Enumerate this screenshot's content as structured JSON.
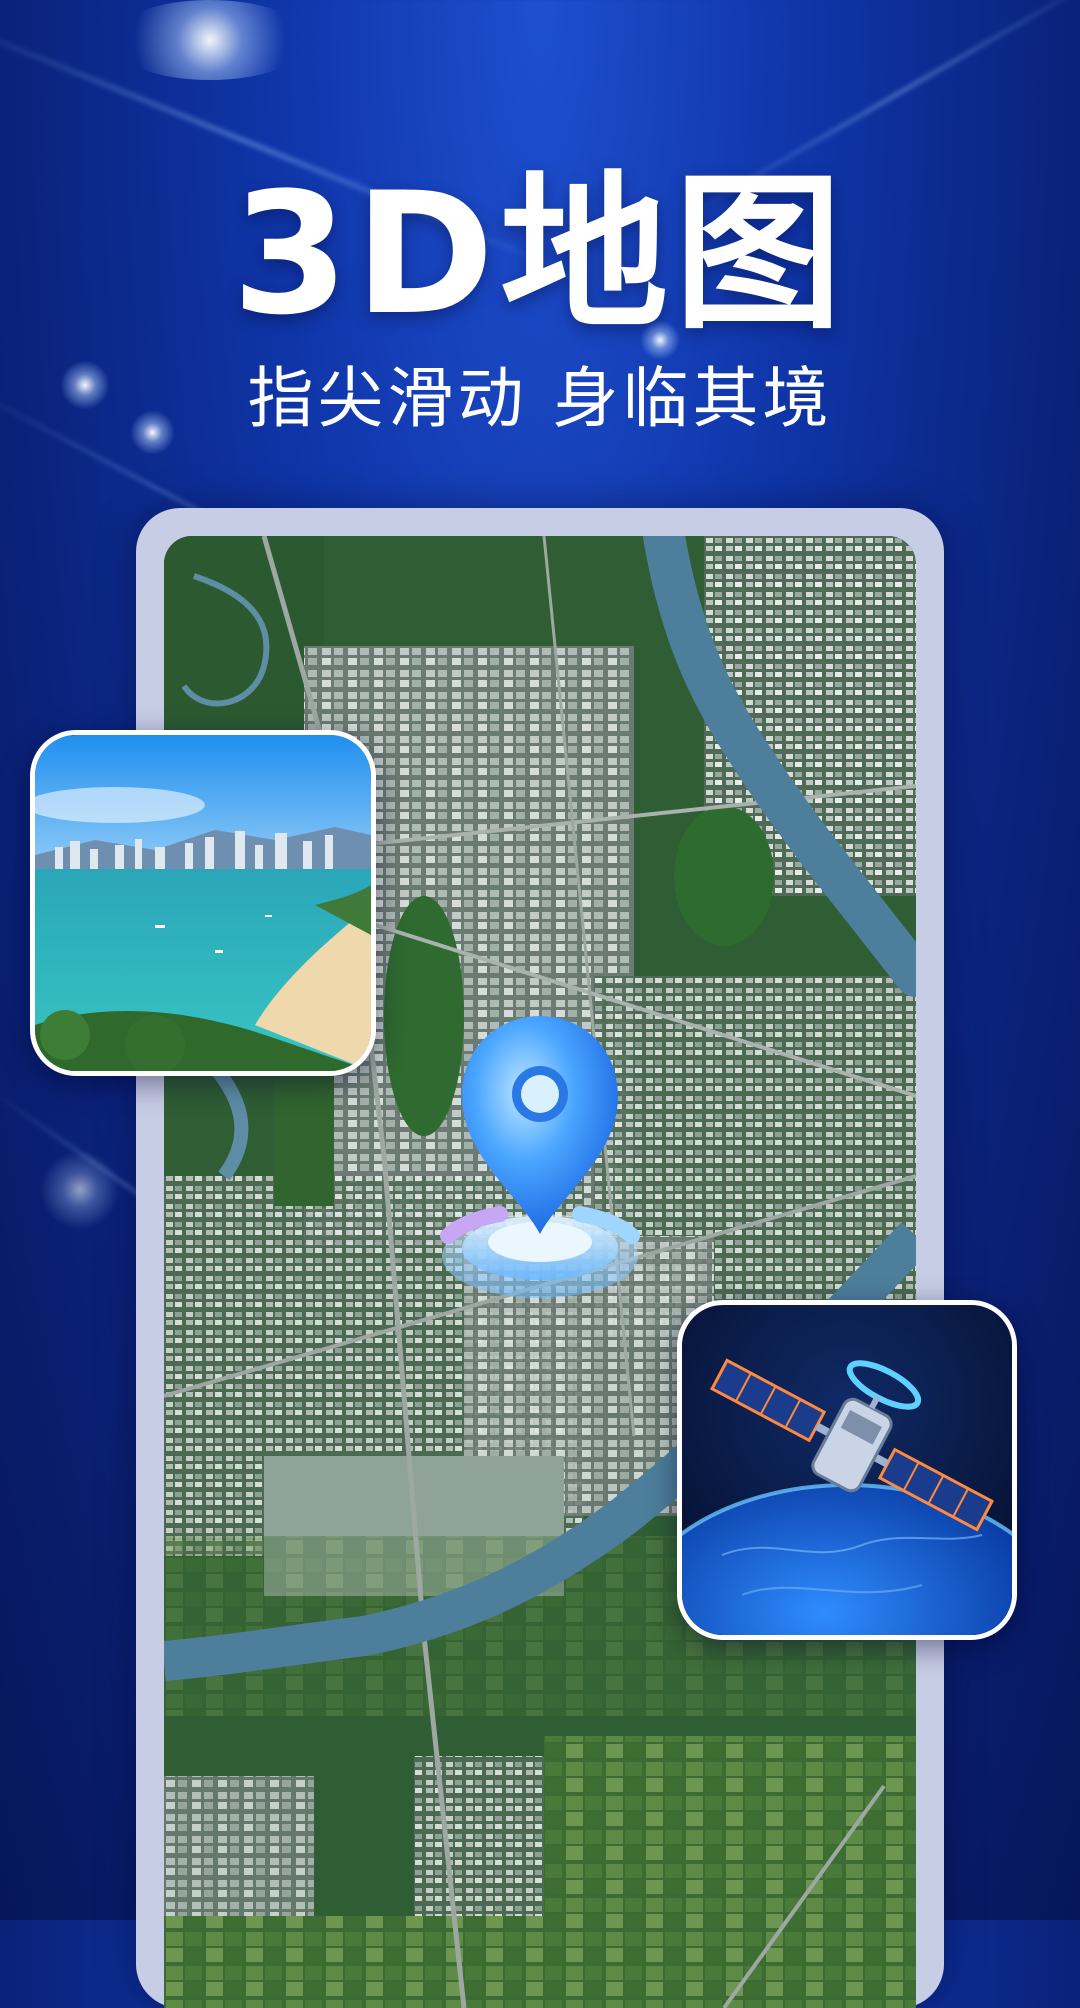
{
  "hero": {
    "title": "3D地图",
    "subtitle": "指尖滑动 身临其境"
  },
  "cards": {
    "left": "beach-city-photo",
    "right": "satellite-orbit-illustration"
  },
  "map": {
    "marker_icon": "location-pin-icon"
  },
  "colors": {
    "background": "#0f35a8",
    "frame": "#c8cde6",
    "river": "#4d7f9c"
  }
}
